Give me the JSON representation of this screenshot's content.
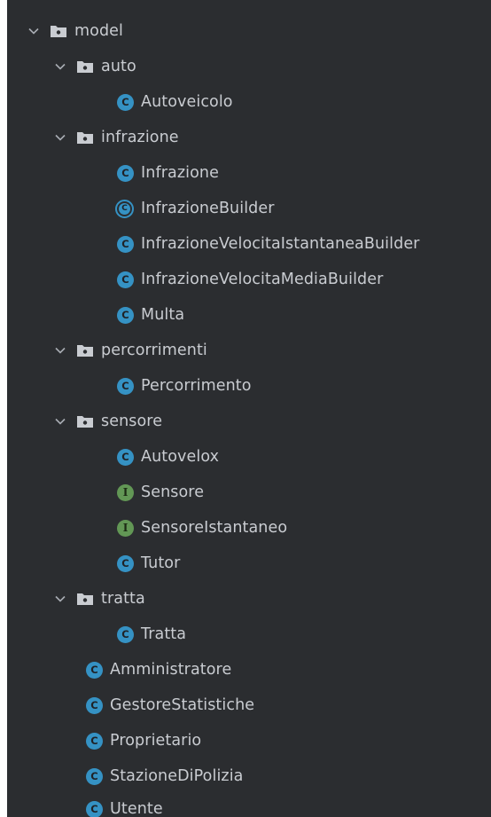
{
  "tree": {
    "root": {
      "label": "model"
    },
    "auto": {
      "label": "auto",
      "children": [
        "Autoveicolo"
      ]
    },
    "infrazione": {
      "label": "infrazione",
      "children": [
        "Infrazione",
        "InfrazioneBuilder",
        "InfrazioneVelocitaIstantaneaBuilder",
        "InfrazioneVelocitaMediaBuilder",
        "Multa"
      ]
    },
    "percorrimenti": {
      "label": "percorrimenti",
      "children": [
        "Percorrimento"
      ]
    },
    "sensore": {
      "label": "sensore",
      "children": [
        "Autovelox",
        "Sensore",
        "SensoreIstantaneo",
        "Tutor"
      ]
    },
    "tratta": {
      "label": "tratta",
      "children": [
        "Tratta"
      ]
    },
    "root_classes": [
      "Amministratore",
      "GestoreStatistiche",
      "Proprietario",
      "StazioneDiPolizia",
      "Utente"
    ]
  },
  "icons": {
    "class_letter": "C",
    "interface_letter": "I",
    "class_color": "#3592c4",
    "interface_color": "#629755",
    "folder_color": "#c9ccd1"
  }
}
